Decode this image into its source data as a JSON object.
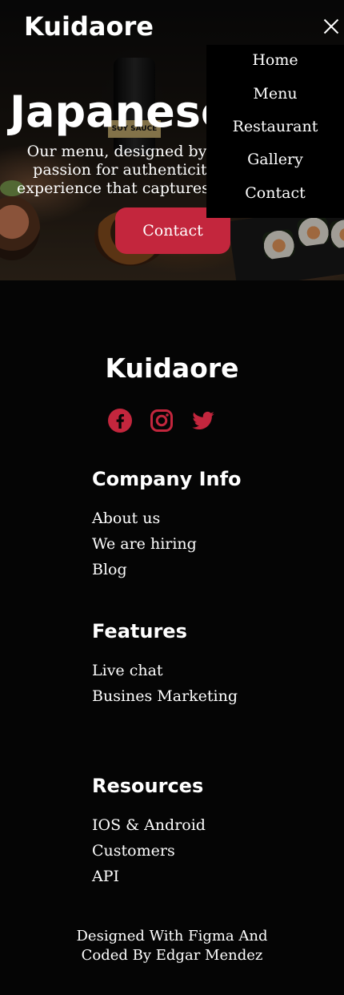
{
  "header": {
    "brand": "Kuidaore"
  },
  "hero": {
    "title": "Japanese",
    "text": "Our menu, designed by ex\npassion for authenticity, \nexperience that captures the",
    "contact_label": "Contact",
    "bottle_label": "SOY SAUCE"
  },
  "nav": {
    "items": [
      "Home",
      "Menu",
      "Restaurant",
      "Gallery",
      "Contact"
    ]
  },
  "footer": {
    "brand": "Kuidaore",
    "social": [
      "facebook-icon",
      "instagram-icon",
      "twitter-icon"
    ],
    "accent_color": "#c3263d",
    "sections": [
      {
        "title": "Company Info",
        "links": [
          "About us",
          "We are hiring",
          "Blog"
        ]
      },
      {
        "title": "Features",
        "links": [
          "Live chat",
          "Busines Marketing"
        ]
      },
      {
        "title": "Resources",
        "links": [
          "IOS & Android",
          "Customers",
          "API"
        ]
      }
    ],
    "credit": "Designed With Figma And\nCoded By Edgar Mendez"
  }
}
